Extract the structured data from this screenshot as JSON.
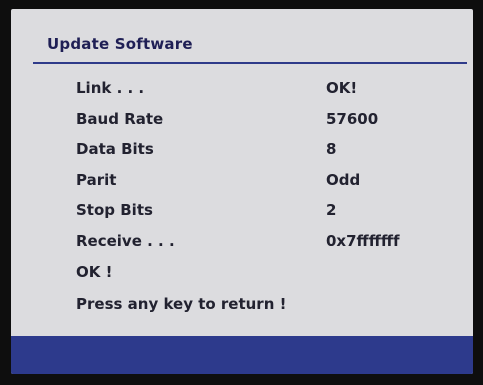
{
  "menu": {
    "title": "Update Software"
  },
  "rows": [
    {
      "label": "Link . . .",
      "value": "OK!"
    },
    {
      "label": "Baud Rate",
      "value": "57600"
    },
    {
      "label": "Data Bits",
      "value": "8"
    },
    {
      "label": "Parit",
      "value": "Odd"
    },
    {
      "label": "Stop Bits",
      "value": "2"
    },
    {
      "label": "Receive . . .",
      "value": "0x7fffffff"
    }
  ],
  "messages": {
    "ok": "OK !",
    "return_prompt": "Press any key to return !"
  },
  "colors": {
    "panel_background": "#dcdcdf",
    "accent_blue": "#2d3a8c",
    "text": "#222230"
  }
}
